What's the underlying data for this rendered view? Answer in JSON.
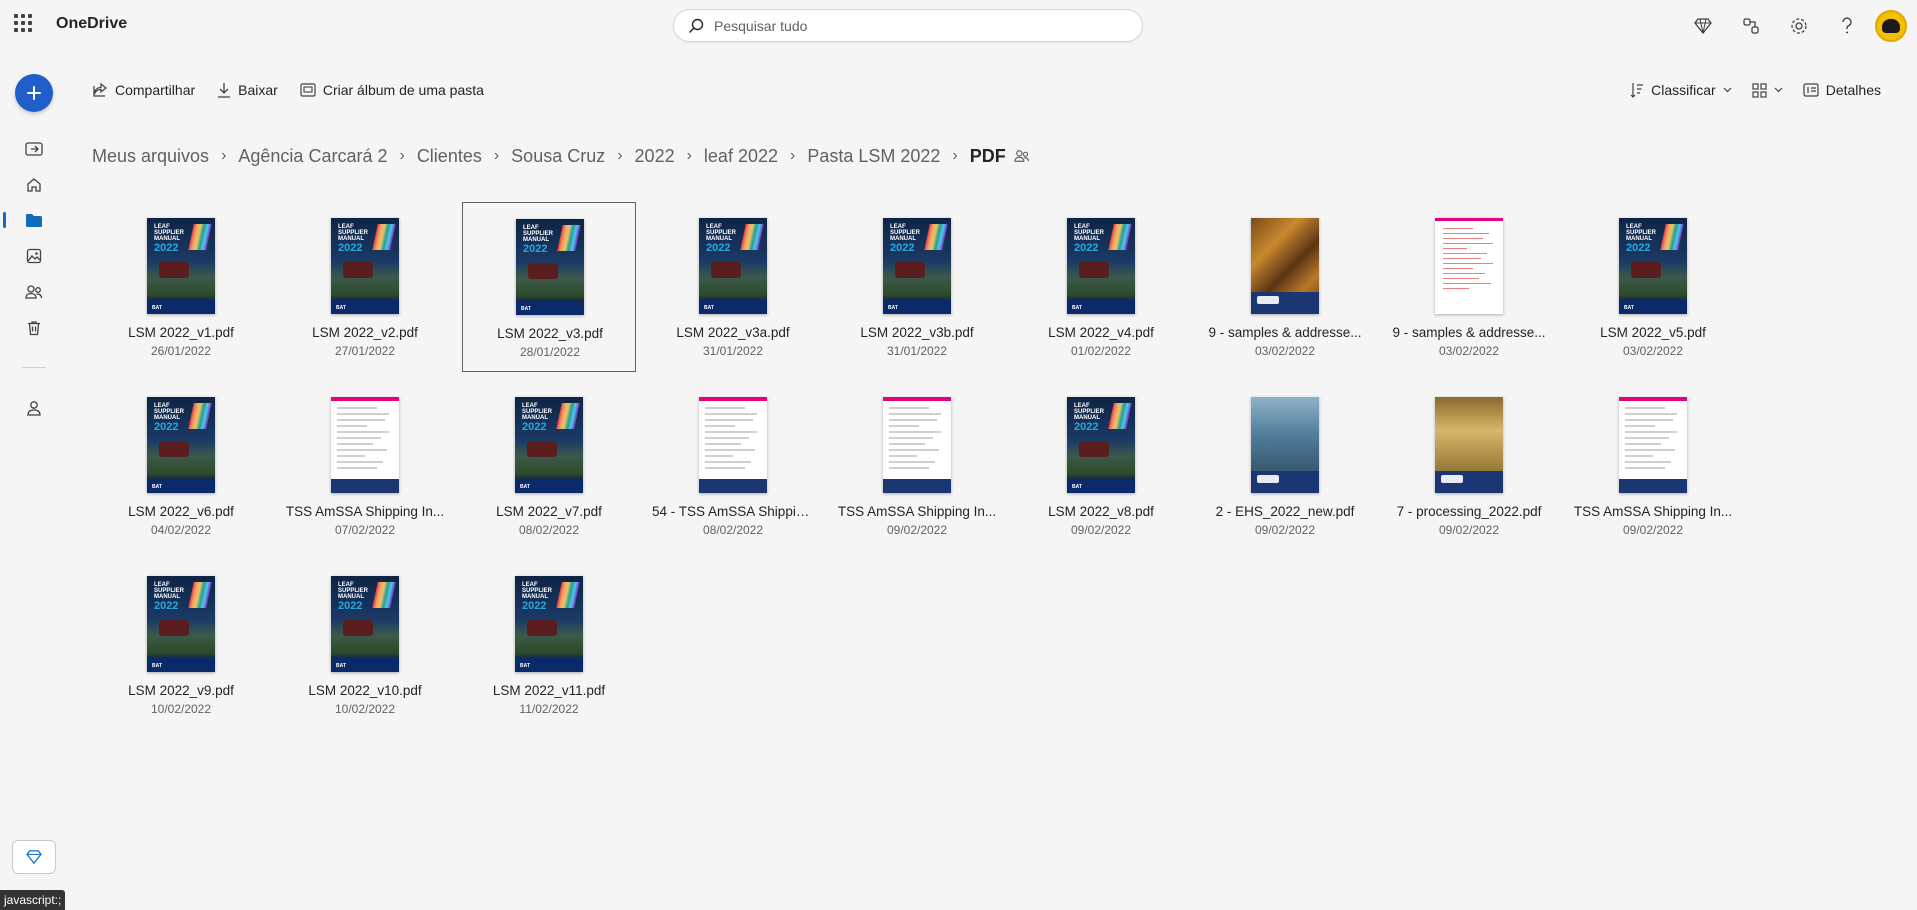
{
  "app": {
    "name": "OneDrive"
  },
  "search": {
    "placeholder": "Pesquisar tudo"
  },
  "commands": {
    "share": "Compartilhar",
    "download": "Baixar",
    "album": "Criar álbum de uma pasta",
    "sort": "Classificar",
    "details": "Detalhes"
  },
  "breadcrumb": {
    "items": [
      "Meus arquivos",
      "Agência Carcará 2",
      "Clientes",
      "Sousa Cruz",
      "2022",
      "leaf 2022",
      "Pasta LSM 2022"
    ],
    "current": "PDF"
  },
  "files": [
    {
      "name": "LSM 2022_v1.pdf",
      "date": "26/01/2022",
      "thumb": "lsm"
    },
    {
      "name": "LSM 2022_v2.pdf",
      "date": "27/01/2022",
      "thumb": "lsm"
    },
    {
      "name": "LSM 2022_v3.pdf",
      "date": "28/01/2022",
      "thumb": "lsm",
      "selected": true
    },
    {
      "name": "LSM 2022_v3a.pdf",
      "date": "31/01/2022",
      "thumb": "lsm"
    },
    {
      "name": "LSM 2022_v3b.pdf",
      "date": "31/01/2022",
      "thumb": "lsm"
    },
    {
      "name": "LSM 2022_v4.pdf",
      "date": "01/02/2022",
      "thumb": "lsm"
    },
    {
      "name": "9 - samples & addresse...",
      "date": "03/02/2022",
      "thumb": "samples"
    },
    {
      "name": "9 - samples & addresse...",
      "date": "03/02/2022",
      "thumb": "doc2"
    },
    {
      "name": "LSM 2022_v5.pdf",
      "date": "03/02/2022",
      "thumb": "lsm"
    },
    {
      "name": "LSM 2022_v6.pdf",
      "date": "04/02/2022",
      "thumb": "lsm"
    },
    {
      "name": "TSS AmSSA Shipping In...",
      "date": "07/02/2022",
      "thumb": "doc"
    },
    {
      "name": "LSM 2022_v7.pdf",
      "date": "08/02/2022",
      "thumb": "lsm"
    },
    {
      "name": "54 - TSS AmSSA Shippin...",
      "date": "08/02/2022",
      "thumb": "doc"
    },
    {
      "name": "TSS AmSSA Shipping In...",
      "date": "09/02/2022",
      "thumb": "doc"
    },
    {
      "name": "LSM 2022_v8.pdf",
      "date": "09/02/2022",
      "thumb": "lsm"
    },
    {
      "name": "2 - EHS_2022_new.pdf",
      "date": "09/02/2022",
      "thumb": "ehs"
    },
    {
      "name": "7 - processing_2022.pdf",
      "date": "09/02/2022",
      "thumb": "proc"
    },
    {
      "name": "TSS AmSSA Shipping In...",
      "date": "09/02/2022",
      "thumb": "doc"
    },
    {
      "name": "LSM 2022_v9.pdf",
      "date": "10/02/2022",
      "thumb": "lsm"
    },
    {
      "name": "LSM 2022_v10.pdf",
      "date": "10/02/2022",
      "thumb": "lsm"
    },
    {
      "name": "LSM 2022_v11.pdf",
      "date": "11/02/2022",
      "thumb": "lsm"
    }
  ],
  "lsm_cover": {
    "line1": "LEAF",
    "line2": "SUPPLIER",
    "line3": "MANUAL",
    "year": "2022",
    "brand": "BAT"
  },
  "status": {
    "text": "javascript:;"
  },
  "colors": {
    "accent": "#0f6cbd",
    "fab": "#1f5fc9",
    "background": "#f5f5f5"
  }
}
